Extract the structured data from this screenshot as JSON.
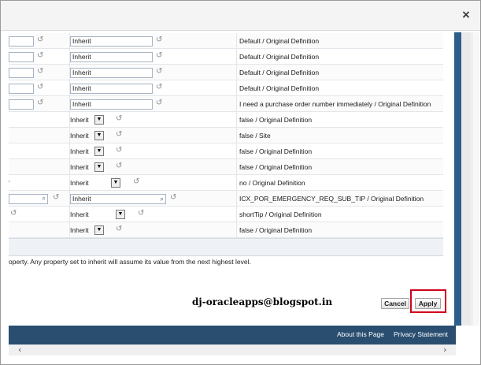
{
  "dialog": {
    "close_glyph": "×"
  },
  "rows": [
    {
      "kind": "text",
      "value": "Inherit",
      "definition": "Default / Original Definition"
    },
    {
      "kind": "text",
      "value": "Inherit",
      "definition": "Default / Original Definition"
    },
    {
      "kind": "text",
      "value": "Inherit",
      "definition": "Default / Original Definition"
    },
    {
      "kind": "text",
      "value": "Inherit",
      "definition": "Default / Original Definition"
    },
    {
      "kind": "text",
      "value": "Inherit",
      "definition": "I need a purchase order number immediately / Original Definition"
    },
    {
      "kind": "select",
      "value": "Inherit",
      "definition": "false / Original Definition"
    },
    {
      "kind": "select",
      "value": "Inherit",
      "definition": "false / Site"
    },
    {
      "kind": "select",
      "value": "Inherit",
      "definition": "false / Original Definition"
    },
    {
      "kind": "select",
      "value": "Inherit",
      "definition": "false / Original Definition"
    },
    {
      "kind": "select-wide",
      "value": "Inherit",
      "definition": "no / Original Definition"
    },
    {
      "kind": "lov",
      "value": "Inherit",
      "definition": "ICX_POR_EMERGENCY_REQ_SUB_TIP / Original Definition"
    },
    {
      "kind": "select-wider",
      "value": "Inherit",
      "definition": "shortTip / Original Definition"
    },
    {
      "kind": "select",
      "value": "Inherit",
      "definition": "false / Original Definition"
    }
  ],
  "footnote": "operty. Any property set to inherit will assume its value from the next highest level.",
  "watermark": "dj-oracleapps@blogspot.in",
  "buttons": {
    "cancel": "Cancel",
    "apply": "Apply"
  },
  "footer": {
    "about": "About this Page",
    "privacy": "Privacy Statement"
  },
  "colors": {
    "footer_bar": "#2a4e70",
    "highlight": "#d0021b"
  }
}
